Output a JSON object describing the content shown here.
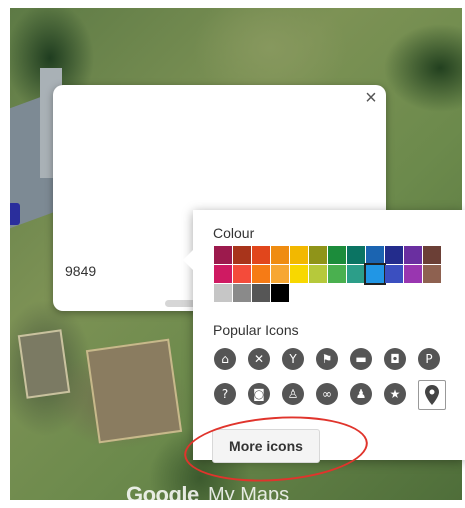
{
  "info_card": {
    "close_glyph": "×",
    "visible_text": "9849"
  },
  "style_popup": {
    "colour_label": "Colour",
    "colour_rows": [
      [
        "#9c1a4d",
        "#a8341b",
        "#e1461c",
        "#ef8c11",
        "#f2b800",
        "#8f9419",
        "#1c8c3b",
        "#0b7463",
        "#1b64b1",
        "#232c8c",
        "#6a2fa0",
        "#6b3f36"
      ],
      [
        "#cf1a62",
        "#f44b3a",
        "#f67b15",
        "#f7a733",
        "#f8d800",
        "#b6c93b",
        "#4ab04f",
        "#2c9e89",
        "#2196e5",
        "#3b4fc0",
        "#9936b0",
        "#8e6150"
      ],
      [
        "#c6c6c6",
        "#8a8a8a",
        "#565656",
        "#000000"
      ]
    ],
    "selected_colour": "#2196e5",
    "popular_icons_label": "Popular Icons",
    "icons": [
      [
        "home-icon",
        "restaurant-icon",
        "bar-icon",
        "flag-icon",
        "hotel-icon",
        "shopping-icon",
        "parking-icon"
      ],
      [
        "help-icon",
        "camera-icon",
        "hiking-icon",
        "bicycle-icon",
        "running-icon",
        "star-icon",
        "pin-icon"
      ]
    ],
    "more_icons_label": "More icons"
  },
  "branding": {
    "google": "Google",
    "my_maps": "My Maps"
  },
  "colors": {
    "annotation_red": "#e0342c"
  }
}
